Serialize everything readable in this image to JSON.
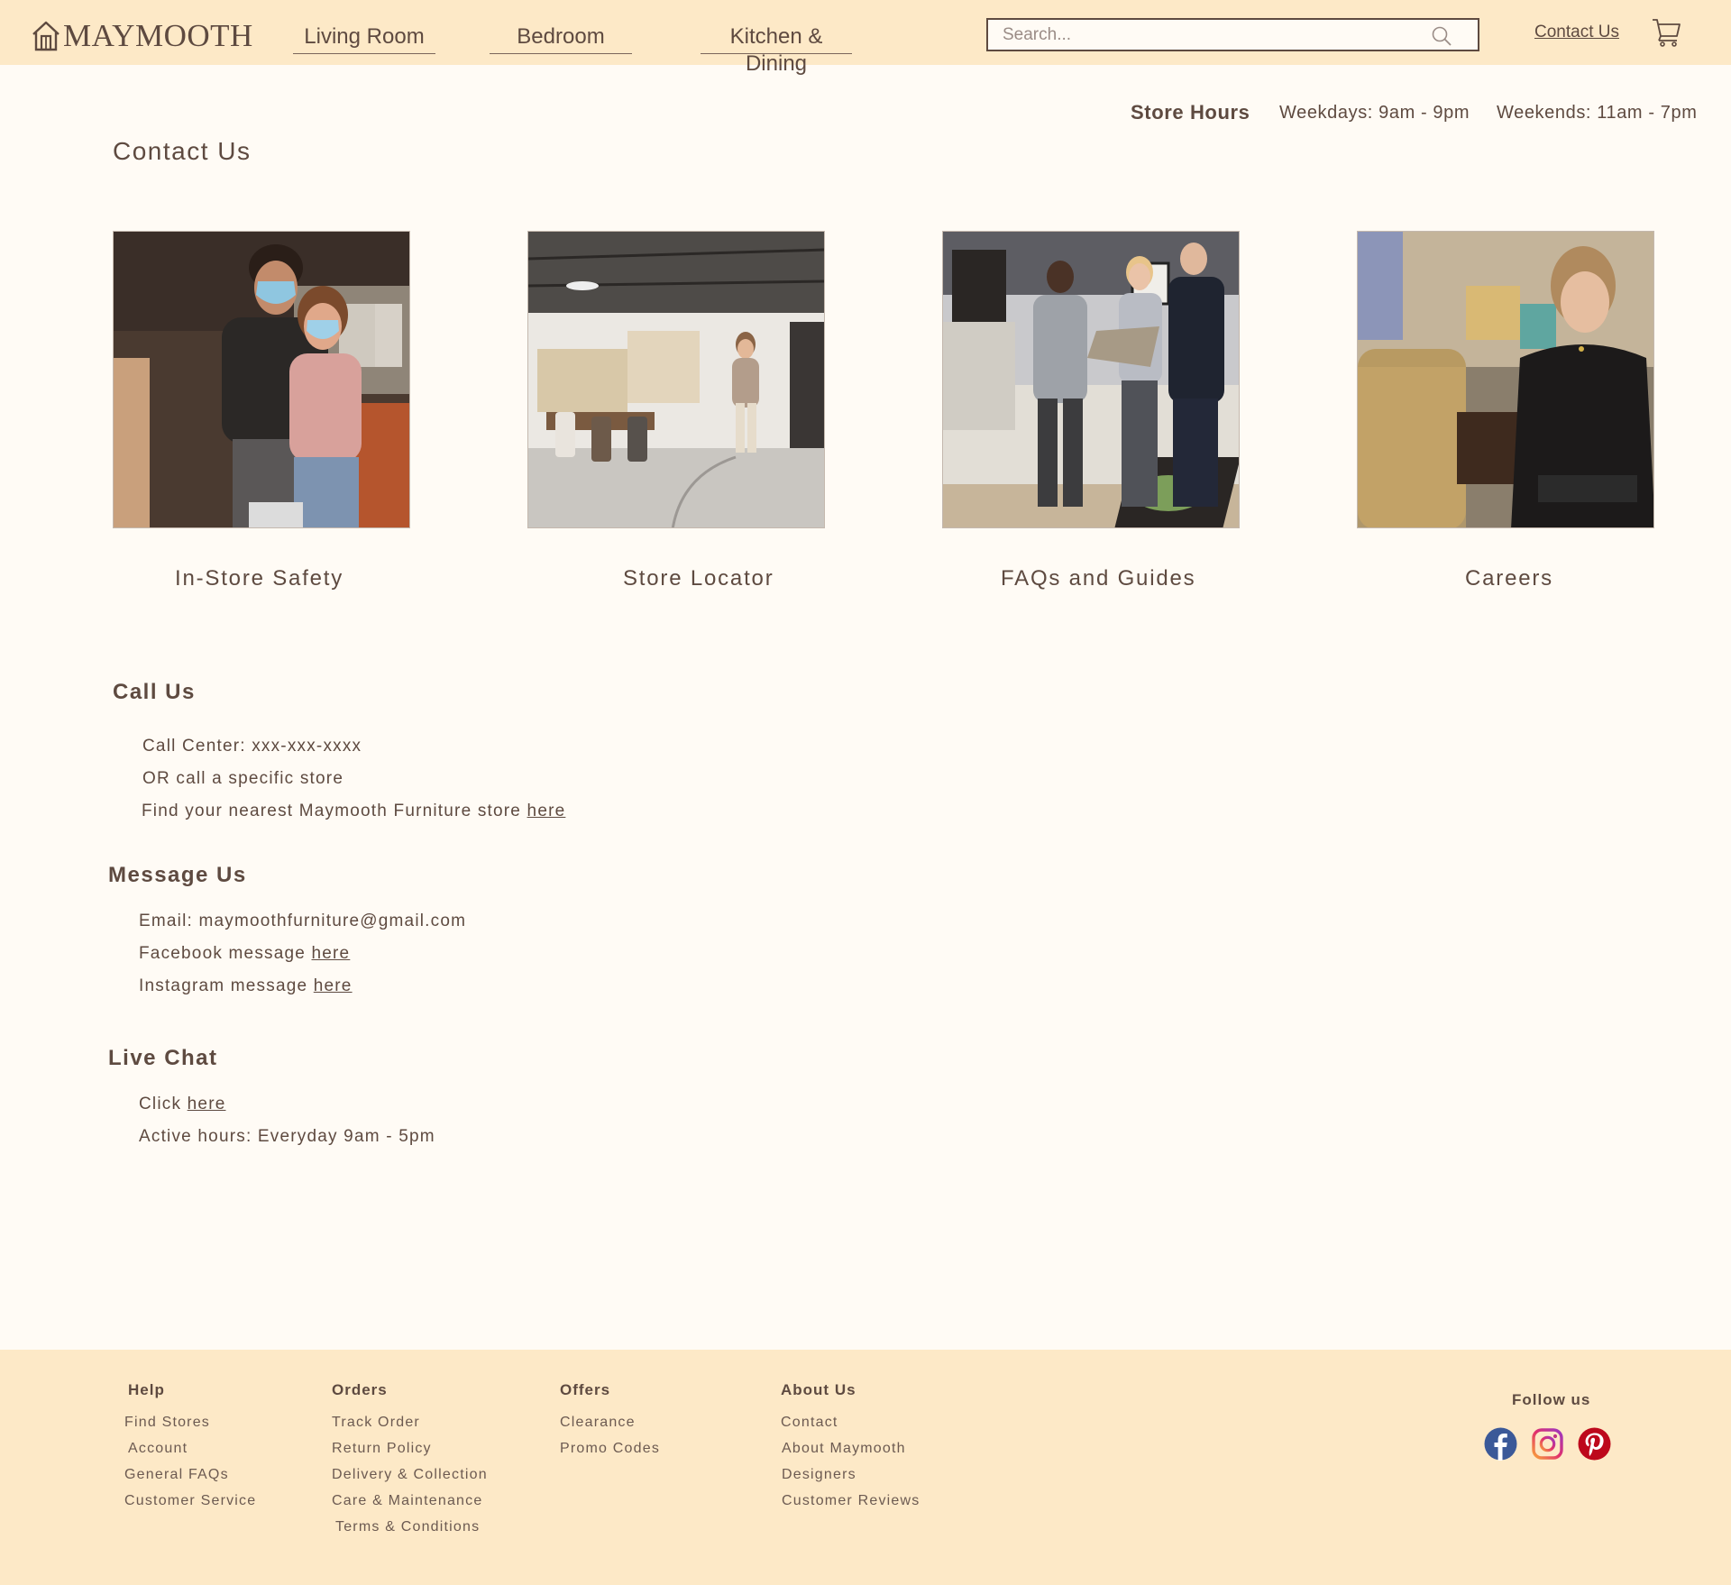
{
  "brand": {
    "name": "MAYMOOTH"
  },
  "nav": {
    "items": [
      "Living Room",
      "Bedroom",
      "Kitchen & Dining"
    ]
  },
  "search": {
    "placeholder": "Search..."
  },
  "header": {
    "contact_label": "Contact Us"
  },
  "store_hours": {
    "label": "Store Hours",
    "weekdays": "Weekdays: 9am - 9pm",
    "weekends": "Weekends: 11am - 7pm"
  },
  "page": {
    "title": "Contact Us"
  },
  "cards": [
    {
      "label": "In-Store Safety"
    },
    {
      "label": "Store Locator"
    },
    {
      "label": "FAQs and Guides"
    },
    {
      "label": "Careers"
    }
  ],
  "call_us": {
    "title": "Call Us",
    "call_center": "Call Center: xxx-xxx-xxxx",
    "specific_store": "OR call a specific store",
    "find_store_prefix": "Find your nearest Maymooth Furniture store",
    "link": "here"
  },
  "message_us": {
    "title": "Message Us",
    "email": "Email: maymoothfurniture@gmail.com",
    "facebook_prefix": "Facebook message",
    "instagram_prefix": "Instagram message",
    "link": "here"
  },
  "live_chat": {
    "title": "Live Chat",
    "click_prefix": "Click",
    "link": "here",
    "active_hours": "Active hours: Everyday 9am - 5pm"
  },
  "footer": {
    "columns": [
      {
        "heading": "Help",
        "items": [
          "Find Stores",
          "Account",
          "General FAQs",
          "Customer Service"
        ]
      },
      {
        "heading": "Orders",
        "items": [
          "Track Order",
          "Return Policy",
          "Delivery & Collection",
          "Care & Maintenance",
          "Terms & Conditions"
        ]
      },
      {
        "heading": "Offers",
        "items": [
          "Clearance",
          "Promo Codes"
        ]
      },
      {
        "heading": "About Us",
        "items": [
          "Contact",
          "About Maymooth",
          "Designers",
          "Customer Reviews"
        ]
      }
    ],
    "follow_label": "Follow us",
    "socials": [
      {
        "icon": "facebook-icon",
        "color": "#3b5998"
      },
      {
        "icon": "instagram-icon",
        "color": "#d6249f"
      },
      {
        "icon": "pinterest-icon",
        "color": "#bd081c"
      }
    ]
  },
  "colors": {
    "header_bg": "#fde9c7",
    "page_bg": "#fffbf5",
    "text": "#5e4a40"
  }
}
